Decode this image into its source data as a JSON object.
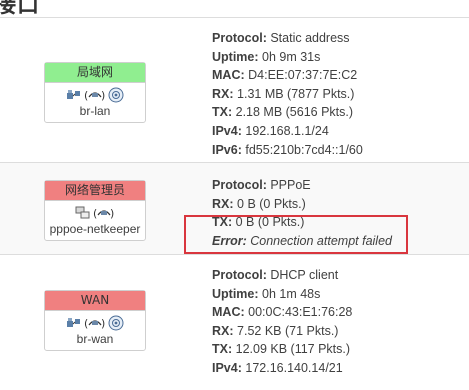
{
  "page": {
    "title": "接口"
  },
  "colors": {
    "lan": "#90ee90",
    "pppoe": "#f08080",
    "wan": "#f08080",
    "highlight": "#d9363e"
  },
  "interfaces": [
    {
      "name": "局域网",
      "device": "br-lan",
      "icons": [
        "ethernet-port-icon",
        "bridge-icon",
        "wifi-icon"
      ],
      "status": [
        {
          "key": "Protocol:",
          "value": "Static address"
        },
        {
          "key": "Uptime:",
          "value": "0h 9m 31s"
        },
        {
          "key": "MAC:",
          "value": "D4:EE:07:37:7E:C2"
        },
        {
          "key": "RX:",
          "value": "1.31 MB (7877 Pkts.)"
        },
        {
          "key": "TX:",
          "value": "2.18 MB (5616 Pkts.)"
        },
        {
          "key": "IPv4:",
          "value": "192.168.1.1/24"
        },
        {
          "key": "IPv6:",
          "value": "fd55:210b:7cd4::1/60"
        }
      ]
    },
    {
      "name": "网络管理员",
      "device": "pppoe-netkeeper",
      "icons": [
        "tunnel-icon",
        "bridge-icon"
      ],
      "status": [
        {
          "key": "Protocol:",
          "value": "PPPoE"
        },
        {
          "key": "RX:",
          "value": "0 B (0 Pkts.)"
        },
        {
          "key": "TX:",
          "value": "0 B (0 Pkts.)"
        }
      ],
      "error": {
        "key": "Error:",
        "value": "Connection attempt failed"
      }
    },
    {
      "name": "WAN",
      "device": "br-wan",
      "icons": [
        "ethernet-port-icon",
        "bridge-icon",
        "wifi-icon"
      ],
      "status": [
        {
          "key": "Protocol:",
          "value": "DHCP client"
        },
        {
          "key": "Uptime:",
          "value": "0h 1m 48s"
        },
        {
          "key": "MAC:",
          "value": "00:0C:43:E1:76:28"
        },
        {
          "key": "RX:",
          "value": "7.52 KB (71 Pkts.)"
        },
        {
          "key": "TX:",
          "value": "12.09 KB (117 Pkts.)"
        },
        {
          "key": "IPv4:",
          "value": "172.16.140.14/21"
        }
      ]
    }
  ]
}
